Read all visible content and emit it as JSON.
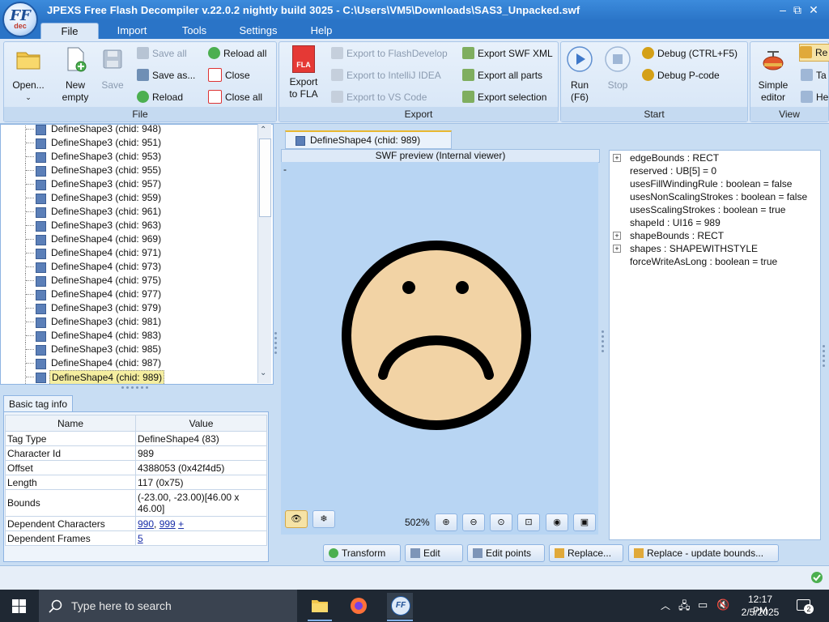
{
  "window": {
    "title": "JPEXS Free Flash Decompiler v.22.0.2 nightly build 3025 - C:\\Users\\VM5\\Downloads\\SAS3_Unpacked.swf",
    "logo_text": "FF",
    "logo_sub": "dec",
    "minimize": "‒",
    "restore": "⧉",
    "close": "✕"
  },
  "menu": {
    "tabs": [
      {
        "label": "File"
      },
      {
        "label": "Import"
      },
      {
        "label": "Tools"
      },
      {
        "label": "Settings"
      },
      {
        "label": "Help"
      }
    ]
  },
  "ribbon": {
    "file": {
      "title": "File",
      "open": "Open...",
      "new_empty": "New\nempty",
      "save": "Save",
      "save_all": "Save all",
      "save_as": "Save as...",
      "reload": "Reload",
      "reload_all": "Reload all",
      "close": "Close",
      "close_all": "Close all"
    },
    "export": {
      "title": "Export",
      "export_fla": "Export\nto FLA",
      "fla_badge": "FLA",
      "export_flashdevelop": "Export to FlashDevelop",
      "export_intellij": "Export to IntelliJ IDEA",
      "export_vscode": "Export to VS Code",
      "export_swf_xml": "Export SWF XML",
      "export_all_parts": "Export all parts",
      "export_selection": "Export selection"
    },
    "start": {
      "title": "Start",
      "run": "Run\n(F6)",
      "stop": "Stop",
      "debug": "Debug (CTRL+F5)",
      "debug_pcode": "Debug P-code"
    },
    "view": {
      "title": "View",
      "simple_editor": "Simple\neditor",
      "r1": "Re",
      "r2": "Ta",
      "r3": "He"
    }
  },
  "tree": {
    "items": [
      {
        "label": "DefineShape3 (chid: 948)"
      },
      {
        "label": "DefineShape3 (chid: 951)"
      },
      {
        "label": "DefineShape3 (chid: 953)"
      },
      {
        "label": "DefineShape3 (chid: 955)"
      },
      {
        "label": "DefineShape3 (chid: 957)"
      },
      {
        "label": "DefineShape3 (chid: 959)"
      },
      {
        "label": "DefineShape3 (chid: 961)"
      },
      {
        "label": "DefineShape3 (chid: 963)"
      },
      {
        "label": "DefineShape4 (chid: 969)"
      },
      {
        "label": "DefineShape4 (chid: 971)"
      },
      {
        "label": "DefineShape4 (chid: 973)"
      },
      {
        "label": "DefineShape4 (chid: 975)"
      },
      {
        "label": "DefineShape4 (chid: 977)"
      },
      {
        "label": "DefineShape3 (chid: 979)"
      },
      {
        "label": "DefineShape3 (chid: 981)"
      },
      {
        "label": "DefineShape4 (chid: 983)"
      },
      {
        "label": "DefineShape3 (chid: 985)"
      },
      {
        "label": "DefineShape4 (chid: 987)"
      },
      {
        "label": "DefineShape4 (chid: 989)",
        "selected": true
      }
    ]
  },
  "basic_tag_info": {
    "tab_label": "Basic tag info",
    "col_name": "Name",
    "col_value": "Value",
    "rows": [
      {
        "name": "Tag Type",
        "value": "DefineShape4 (83)"
      },
      {
        "name": "Character Id",
        "value": "989"
      },
      {
        "name": "Offset",
        "value": "4388053 (0x42f4d5)"
      },
      {
        "name": "Length",
        "value": "117 (0x75)"
      },
      {
        "name": "Bounds",
        "value": "(-23.00, -23.00)[46.00 x 46.00]"
      }
    ],
    "dependent_characters_label": "Dependent Characters",
    "dependent_characters": [
      "990",
      "999"
    ],
    "dependent_more": "+",
    "dependent_frames_label": "Dependent Frames",
    "dependent_frames": "5"
  },
  "preview": {
    "tab_label": "DefineShape4 (chid: 989)",
    "header": "SWF preview (Internal viewer)",
    "dash": "-",
    "zoom": "502%",
    "face_fill": "#f2d3a5",
    "face_stroke": "#000000"
  },
  "actions": {
    "transform": "Transform",
    "edit": "Edit",
    "edit_points": "Edit points",
    "replace": "Replace...",
    "replace_update": "Replace - update bounds..."
  },
  "properties": {
    "rows": [
      {
        "text": "edgeBounds : RECT",
        "expandable": true
      },
      {
        "text": "reserved : UB[5] = 0",
        "expandable": false
      },
      {
        "text": "usesFillWindingRule : boolean = false",
        "expandable": false
      },
      {
        "text": "usesNonScalingStrokes : boolean = false",
        "expandable": false
      },
      {
        "text": "usesScalingStrokes : boolean = true",
        "expandable": false
      },
      {
        "text": "shapeId : UI16 = 989",
        "expandable": false
      },
      {
        "text": "shapeBounds : RECT",
        "expandable": true
      },
      {
        "text": "shapes : SHAPEWITHSTYLE",
        "expandable": true
      },
      {
        "text": "forceWriteAsLong : boolean = true",
        "expandable": false
      }
    ]
  },
  "taskbar": {
    "search_placeholder": "Type here to search",
    "time": "12:17 PM",
    "date": "2/5/2025",
    "notification_count": "2"
  }
}
